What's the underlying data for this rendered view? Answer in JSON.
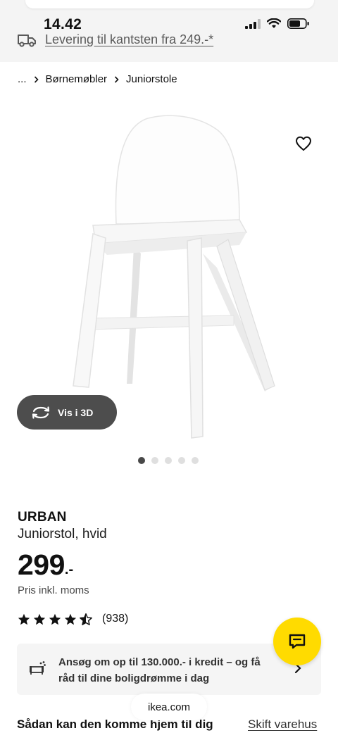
{
  "status_bar": {
    "time": "14.42"
  },
  "delivery_banner": {
    "text": "Levering til kantsten fra 249.-*"
  },
  "breadcrumb": {
    "ellipsis": "...",
    "items": [
      "Børnemøbler",
      "Juniorstole"
    ]
  },
  "gallery": {
    "view_3d_label": "Vis i 3D",
    "dot_count": 5,
    "active_dot": 0
  },
  "product": {
    "name": "URBAN",
    "description": "Juniorstol, hvid",
    "price_integer": "299",
    "price_suffix": ".-",
    "price_note": "Pris inkl. moms",
    "rating": {
      "stars": 4.5,
      "max": 5,
      "count": "(938)"
    }
  },
  "credit": {
    "text": "Ansøg om op til 130.000.- i kredit – og få råd til dine boligdrømme i dag"
  },
  "delivery_section": {
    "heading": "Sådan kan den komme hjem til dig",
    "change_store": "Skift varehus"
  },
  "browser": {
    "url": "ikea.com"
  },
  "colors": {
    "chat_button": "#ffdb00",
    "view3d_button": "#4d4d4d",
    "active_dot": "#484848"
  }
}
